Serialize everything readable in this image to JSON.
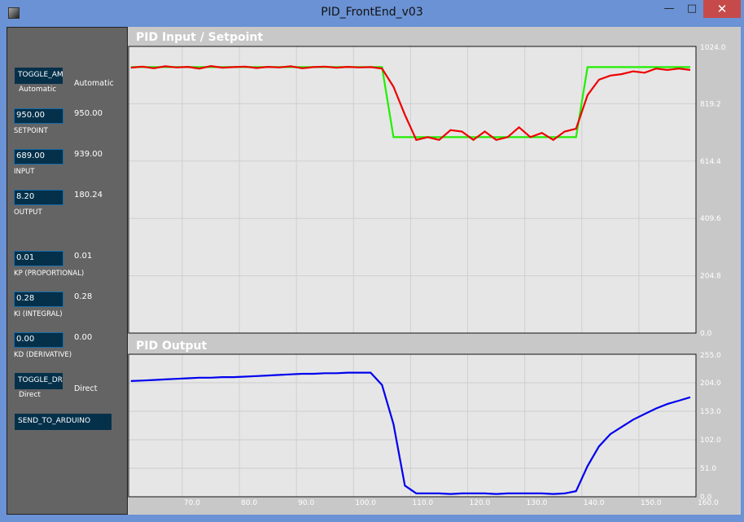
{
  "window": {
    "title": "PID_FrontEnd_v03",
    "minimize": "—",
    "maximize": "□",
    "close": "✕"
  },
  "panel": {
    "toggle_am": {
      "button": "TOGGLE_AM",
      "caption": "Automatic",
      "value": "Automatic"
    },
    "setpoint": {
      "input": "950.00",
      "label": "SETPOINT",
      "value": "950.00"
    },
    "input": {
      "input": "689.00",
      "label": "INPUT",
      "value": "939.00"
    },
    "output": {
      "input": "8.20",
      "label": "OUTPUT",
      "value": "180.24"
    },
    "kp": {
      "input": "0.01",
      "label": "KP (PROPORTIONAL)",
      "value": "0.01"
    },
    "ki": {
      "input": "0.28",
      "label": "KI (INTEGRAL)",
      "value": "0.28"
    },
    "kd": {
      "input": "0.00",
      "label": "KD (DERIVATIVE)",
      "value": "0.00"
    },
    "toggle_dr": {
      "button": "TOGGLE_DR",
      "caption": "Direct",
      "value": "Direct"
    },
    "send": "SEND_TO_ARDUINO"
  },
  "colors": {
    "setpoint": "#22ee00",
    "input": "#ee0000",
    "output": "#0000ee"
  },
  "chart_data": [
    {
      "type": "line",
      "title": "PID Input / Setpoint",
      "ylim": [
        0,
        1024
      ],
      "xlim": [
        60.6,
        160
      ],
      "yticks": [
        "1024.0",
        "819.2",
        "614.4",
        "409.6",
        "204.8",
        "0.0"
      ],
      "x": [
        61,
        63,
        65,
        67,
        69,
        71,
        73,
        75,
        77,
        79,
        81,
        83,
        85,
        87,
        89,
        91,
        93,
        95,
        97,
        99,
        101,
        103,
        105,
        107,
        109,
        111,
        113,
        115,
        117,
        119,
        121,
        123,
        125,
        127,
        129,
        131,
        133,
        135,
        137,
        139,
        141,
        143,
        145,
        147,
        149,
        151,
        153,
        155,
        157,
        159
      ],
      "series": [
        {
          "name": "Setpoint",
          "values": [
            950,
            950,
            950,
            950,
            950,
            950,
            950,
            950,
            950,
            950,
            950,
            950,
            950,
            950,
            950,
            950,
            950,
            950,
            950,
            950,
            950,
            950,
            950,
            700,
            700,
            700,
            700,
            700,
            700,
            700,
            700,
            700,
            700,
            700,
            700,
            700,
            700,
            700,
            700,
            700,
            950,
            950,
            950,
            950,
            950,
            950,
            950,
            950,
            950,
            950
          ]
        },
        {
          "name": "Input",
          "values": [
            948,
            952,
            946,
            953,
            949,
            951,
            945,
            954,
            948,
            950,
            952,
            947,
            951,
            949,
            953,
            946,
            950,
            952,
            948,
            951,
            949,
            950,
            945,
            880,
            780,
            690,
            700,
            690,
            725,
            720,
            690,
            720,
            690,
            700,
            735,
            700,
            715,
            690,
            720,
            730,
            850,
            905,
            920,
            925,
            935,
            930,
            945,
            940,
            945,
            940
          ]
        }
      ]
    },
    {
      "type": "line",
      "title": "PID Output",
      "ylim": [
        0,
        255
      ],
      "xlim": [
        60.6,
        160
      ],
      "yticks": [
        "255.0",
        "204.0",
        "153.0",
        "102.0",
        "51.0",
        "0.0"
      ],
      "xticks": [
        "70.0",
        "80.0",
        "90.0",
        "100.0",
        "110.0",
        "120.0",
        "130.0",
        "140.0",
        "150.0",
        "160.0"
      ],
      "x": [
        61,
        63,
        65,
        67,
        69,
        71,
        73,
        75,
        77,
        79,
        81,
        83,
        85,
        87,
        89,
        91,
        93,
        95,
        97,
        99,
        101,
        103,
        105,
        107,
        109,
        111,
        113,
        115,
        117,
        119,
        121,
        123,
        125,
        127,
        129,
        131,
        133,
        135,
        137,
        139,
        141,
        143,
        145,
        147,
        149,
        151,
        153,
        155,
        157,
        159
      ],
      "series": [
        {
          "name": "Output",
          "values": [
            207,
            208,
            209,
            210,
            211,
            212,
            213,
            213,
            214,
            214,
            215,
            216,
            217,
            218,
            219,
            220,
            220,
            221,
            221,
            222,
            222,
            222,
            200,
            130,
            20,
            6,
            6,
            6,
            5,
            6,
            6,
            6,
            5,
            6,
            6,
            6,
            6,
            5,
            6,
            10,
            55,
            90,
            112,
            125,
            138,
            148,
            158,
            166,
            172,
            178
          ]
        }
      ]
    }
  ]
}
